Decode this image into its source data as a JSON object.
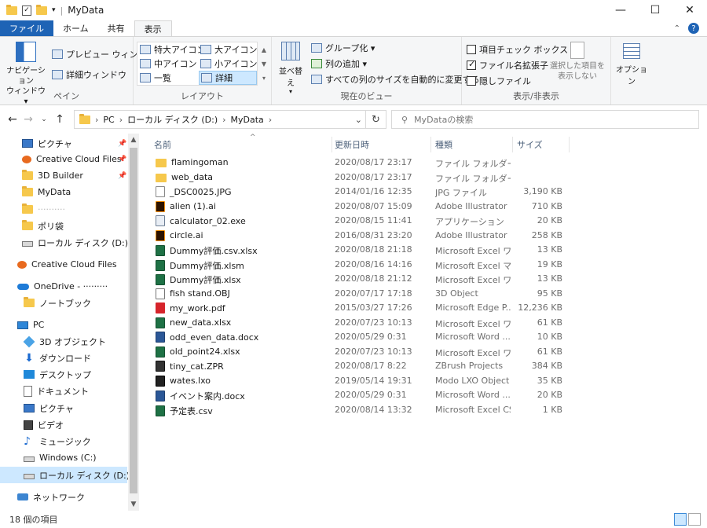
{
  "window": {
    "title": "MyData",
    "minimize": "—",
    "maximize": "☐",
    "close": "✕"
  },
  "tabs": [
    {
      "label": "ファイル"
    },
    {
      "label": "ホーム"
    },
    {
      "label": "共有"
    },
    {
      "label": "表示"
    }
  ],
  "ribbon": {
    "pane": {
      "nav_pane": "ナビゲーション\nウィンドウ▾",
      "preview": "プレビュー ウィンドウ",
      "details": "詳細ウィンドウ",
      "group": "ペイン"
    },
    "layout": {
      "items": [
        "特大アイコン",
        "大アイコン",
        "中アイコン",
        "小アイコン",
        "一覧",
        "詳細"
      ],
      "group": "レイアウト"
    },
    "current_view": {
      "sort": "並べ替え",
      "group_by": "グループ化 ▾",
      "add_column": "列の追加 ▾",
      "fit_columns": "すべての列のサイズを自動的に変更する",
      "group": "現在のビュー"
    },
    "show_hide": {
      "item_checkbox": "項目チェック ボックス",
      "extensions": "ファイル名拡張子",
      "hidden": "隠しファイル",
      "hide_selected": "選択した項目を\n表示しない",
      "group": "表示/非表示"
    },
    "options": "オプション"
  },
  "address": {
    "segments": [
      "PC",
      "ローカル ディスク (D:)",
      "MyData"
    ],
    "search_placeholder": "MyDataの検索"
  },
  "nav_items": [
    {
      "label": "ピクチャ",
      "icon": "pictures-icon",
      "pinned": true
    },
    {
      "label": "Creative Cloud Files",
      "icon": "creative-cloud-icon",
      "pinned": true
    },
    {
      "label": "3D Builder",
      "icon": "folder-icon",
      "pinned": true
    },
    {
      "label": "MyData",
      "icon": "folder-icon",
      "pinned": false
    },
    {
      "label": "··········",
      "icon": "folder-icon",
      "pinned": false
    },
    {
      "label": "ポリ袋",
      "icon": "folder-icon",
      "pinned": false
    },
    {
      "label": "ローカル ディスク (D:)",
      "icon": "drive-icon",
      "pinned": false
    },
    {
      "label": "Creative Cloud Files",
      "icon": "creative-cloud-icon",
      "pinned": false
    },
    {
      "label": "OneDrive - ·········",
      "icon": "onedrive-icon",
      "pinned": false
    },
    {
      "label": "ノートブック",
      "icon": "folder-icon",
      "pinned": false
    },
    {
      "label": "PC",
      "icon": "pc-icon",
      "pinned": false
    },
    {
      "label": "3D オブジェクト",
      "icon": "3d-objects-icon",
      "pinned": false
    },
    {
      "label": "ダウンロード",
      "icon": "download-icon",
      "pinned": false
    },
    {
      "label": "デスクトップ",
      "icon": "desktop-icon",
      "pinned": false
    },
    {
      "label": "ドキュメント",
      "icon": "documents-icon",
      "pinned": false
    },
    {
      "label": "ピクチャ",
      "icon": "pictures-icon",
      "pinned": false
    },
    {
      "label": "ビデオ",
      "icon": "video-icon",
      "pinned": false
    },
    {
      "label": "ミュージック",
      "icon": "music-icon",
      "pinned": false
    },
    {
      "label": "Windows (C:)",
      "icon": "drive-icon",
      "pinned": false
    },
    {
      "label": "ローカル ディスク (D:)",
      "icon": "drive-icon",
      "pinned": false
    },
    {
      "label": "ネットワーク",
      "icon": "network-icon",
      "pinned": false
    }
  ],
  "columns": {
    "name": "名前",
    "date": "更新日時",
    "type": "種類",
    "size": "サイズ"
  },
  "files": [
    {
      "name": "flamingoman",
      "date": "2020/08/17 23:17",
      "type": "ファイル フォルダー",
      "size": "",
      "icon": "folder"
    },
    {
      "name": "web_data",
      "date": "2020/08/17 23:17",
      "type": "ファイル フォルダー",
      "size": "",
      "icon": "folder"
    },
    {
      "name": "_DSC0025.JPG",
      "date": "2014/01/16 12:35",
      "type": "JPG ファイル",
      "size": "3,190 KB",
      "icon": "jpg"
    },
    {
      "name": "alien (1).ai",
      "date": "2020/08/07 15:09",
      "type": "Adobe Illustrator ...",
      "size": "710 KB",
      "icon": "ai"
    },
    {
      "name": "calculator_02.exe",
      "date": "2020/08/15 11:41",
      "type": "アプリケーション",
      "size": "20 KB",
      "icon": "exe"
    },
    {
      "name": "circle.ai",
      "date": "2016/08/31 23:20",
      "type": "Adobe Illustrator ...",
      "size": "258 KB",
      "icon": "ai"
    },
    {
      "name": "Dummy評価.csv.xlsx",
      "date": "2020/08/18 21:18",
      "type": "Microsoft Excel ワ...",
      "size": "13 KB",
      "icon": "xls"
    },
    {
      "name": "Dummy評価.xlsm",
      "date": "2020/08/16 14:16",
      "type": "Microsoft Excel マ...",
      "size": "19 KB",
      "icon": "xls"
    },
    {
      "name": "Dummy評価.xlsx",
      "date": "2020/08/18 21:12",
      "type": "Microsoft Excel ワ...",
      "size": "13 KB",
      "icon": "xls"
    },
    {
      "name": "fish stand.OBJ",
      "date": "2020/07/17 17:18",
      "type": "3D Object",
      "size": "95 KB",
      "icon": "obj"
    },
    {
      "name": "my_work.pdf",
      "date": "2015/03/27 17:26",
      "type": "Microsoft Edge P...",
      "size": "12,236 KB",
      "icon": "pdf"
    },
    {
      "name": "new_data.xlsx",
      "date": "2020/07/23 10:13",
      "type": "Microsoft Excel ワ...",
      "size": "61 KB",
      "icon": "xls"
    },
    {
      "name": "odd_even_data.docx",
      "date": "2020/05/29 0:31",
      "type": "Microsoft Word ...",
      "size": "10 KB",
      "icon": "doc"
    },
    {
      "name": "old_point24.xlsx",
      "date": "2020/07/23 10:13",
      "type": "Microsoft Excel ワ...",
      "size": "61 KB",
      "icon": "xls"
    },
    {
      "name": "tiny_cat.ZPR",
      "date": "2020/08/17 8:22",
      "type": "ZBrush Projects",
      "size": "384 KB",
      "icon": "zpr"
    },
    {
      "name": "wates.lxo",
      "date": "2019/05/14 19:31",
      "type": "Modo LXO Object",
      "size": "35 KB",
      "icon": "lxo"
    },
    {
      "name": "イベント案内.docx",
      "date": "2020/05/29 0:31",
      "type": "Microsoft Word ...",
      "size": "20 KB",
      "icon": "doc"
    },
    {
      "name": "予定表.csv",
      "date": "2020/08/14 13:32",
      "type": "Microsoft Excel CS...",
      "size": "1 KB",
      "icon": "csv"
    }
  ],
  "status": {
    "item_count": "18 個の項目"
  },
  "colors": {
    "file_tab": "#1e63b5",
    "selection": "#cde8ff",
    "folder": "#f6c84c"
  }
}
